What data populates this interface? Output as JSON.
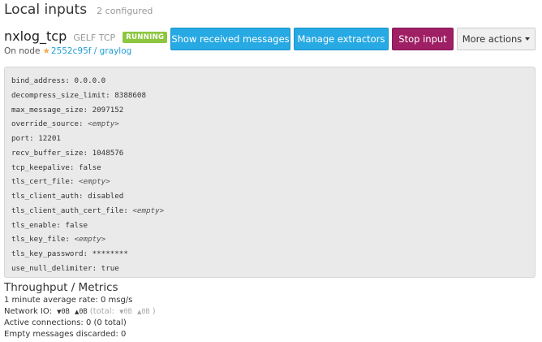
{
  "header": {
    "title": "Local inputs",
    "configured_count": "2 configured"
  },
  "input": {
    "name": "nxlog_tcp",
    "type": "GELF TCP",
    "state": "RUNNING",
    "node_prefix": "On node",
    "node_link": "2552c95f / graylog"
  },
  "actions": {
    "show_messages": "Show received messages",
    "manage_extractors": "Manage extractors",
    "stop_input": "Stop input",
    "more_actions": "More actions"
  },
  "config": [
    {
      "key": "bind_address",
      "value": "0.0.0.0",
      "empty": false
    },
    {
      "key": "decompress_size_limit",
      "value": "8388608",
      "empty": false
    },
    {
      "key": "max_message_size",
      "value": "2097152",
      "empty": false
    },
    {
      "key": "override_source",
      "value": "<empty>",
      "empty": true
    },
    {
      "key": "port",
      "value": "12201",
      "empty": false
    },
    {
      "key": "recv_buffer_size",
      "value": "1048576",
      "empty": false
    },
    {
      "key": "tcp_keepalive",
      "value": "false",
      "empty": false
    },
    {
      "key": "tls_cert_file",
      "value": "<empty>",
      "empty": true
    },
    {
      "key": "tls_client_auth",
      "value": "disabled",
      "empty": false
    },
    {
      "key": "tls_client_auth_cert_file",
      "value": "<empty>",
      "empty": true
    },
    {
      "key": "tls_enable",
      "value": "false",
      "empty": false
    },
    {
      "key": "tls_key_file",
      "value": "<empty>",
      "empty": true
    },
    {
      "key": "tls_key_password",
      "value": "********",
      "empty": false
    },
    {
      "key": "use_null_delimiter",
      "value": "true",
      "empty": false
    }
  ],
  "metrics": {
    "title": "Throughput / Metrics",
    "rate": "1 minute average rate: 0 msg/s",
    "network_label": "Network IO:",
    "net_in": "0B",
    "net_out": "0B",
    "total_label": "(total:",
    "total_in": "0B",
    "total_out": "0B",
    "total_close": ")",
    "connections": "Active connections: 0 (0 total)",
    "empty_discarded": "Empty messages discarded: 0"
  },
  "colors": {
    "info": "#27a9e3",
    "danger": "#9e1f63",
    "running": "#8dc63f",
    "link": "#1e9ed6",
    "star": "#f0ad4e"
  },
  "icons": {
    "node": "star-icon",
    "down_arrow": "caret-down-icon",
    "up_arrow": "caret-up-icon"
  }
}
